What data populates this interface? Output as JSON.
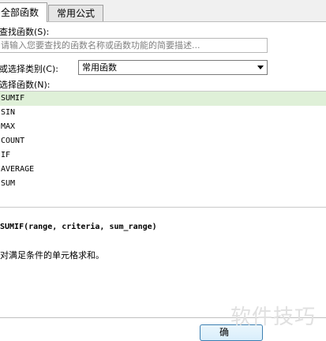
{
  "tabs": [
    {
      "label": "全部函数",
      "active": true
    },
    {
      "label": "常用公式",
      "active": false
    }
  ],
  "search": {
    "label": "查找函数(S):",
    "placeholder": "请输入您要查找的函数名称或函数功能的简要描述..."
  },
  "category": {
    "label": "或选择类别(C):",
    "value": "常用函数"
  },
  "functions": {
    "label": "选择函数(N):",
    "items": [
      "SUMIF",
      "SIN",
      "MAX",
      "COUNT",
      "IF",
      "AVERAGE",
      "SUM"
    ],
    "selected_index": 0
  },
  "detail": {
    "syntax": "SUMIF(range, criteria, sum_range)",
    "description": "对满足条件的单元格求和。"
  },
  "buttons": {
    "ok": "确"
  },
  "watermark": "软件技巧",
  "colors": {
    "selected_row": "#dff0d8",
    "button_border": "#3c7fb1"
  }
}
